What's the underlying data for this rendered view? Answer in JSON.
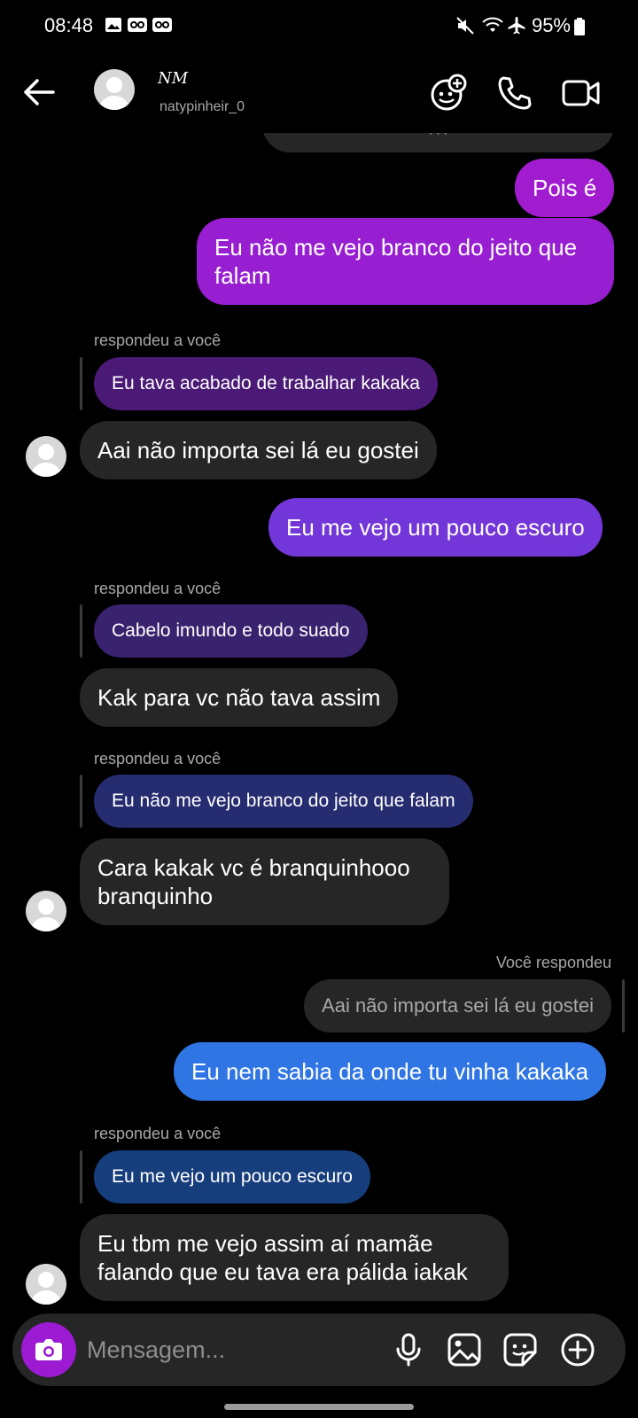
{
  "status_bar": {
    "time": "08:48",
    "battery": "95%"
  },
  "header": {
    "username": "natypinheir_0",
    "display_logo": "NM"
  },
  "messages": {
    "clipped_top": "…",
    "m1": "Pois é",
    "m2_line1": "Eu não me vejo branco do jeito que",
    "m2_line2": "falam",
    "r1_label": "respondeu a você",
    "r1_quote": "Eu tava acabado de trabalhar kakaka",
    "r1_text": "Aai não importa  sei lá eu gostei",
    "m3": "Eu me vejo um pouco escuro",
    "r2_label": "respondeu a você",
    "r2_quote": "Cabelo imundo e todo suado",
    "r2_text": "Kak para vc não tava assim",
    "r3_label": "respondeu a você",
    "r3_quote": "Eu não me vejo branco do jeito que falam",
    "r3_text_line1": "Cara kakak vc é branquinhooo",
    "r3_text_line2": "branquinho",
    "s_label": "Você respondeu",
    "s_quote": "Aai não importa  sei lá eu gostei",
    "s_text": "Eu nem sabia da onde tu vinha kakaka",
    "r4_label": "respondeu a você",
    "r4_quote": "Eu me vejo um pouco escuro",
    "r4_text_line1": "Eu tbm me vejo assim aí mamãe",
    "r4_text_line2": "falando que eu tava era pálida iakak"
  },
  "composer": {
    "placeholder": "Mensagem..."
  },
  "colors": {
    "purple_top": "#a21ccf",
    "purple_mid": "#8a24d8",
    "violet": "#7336d8",
    "blue": "#2f75e3",
    "received": "#262626"
  }
}
